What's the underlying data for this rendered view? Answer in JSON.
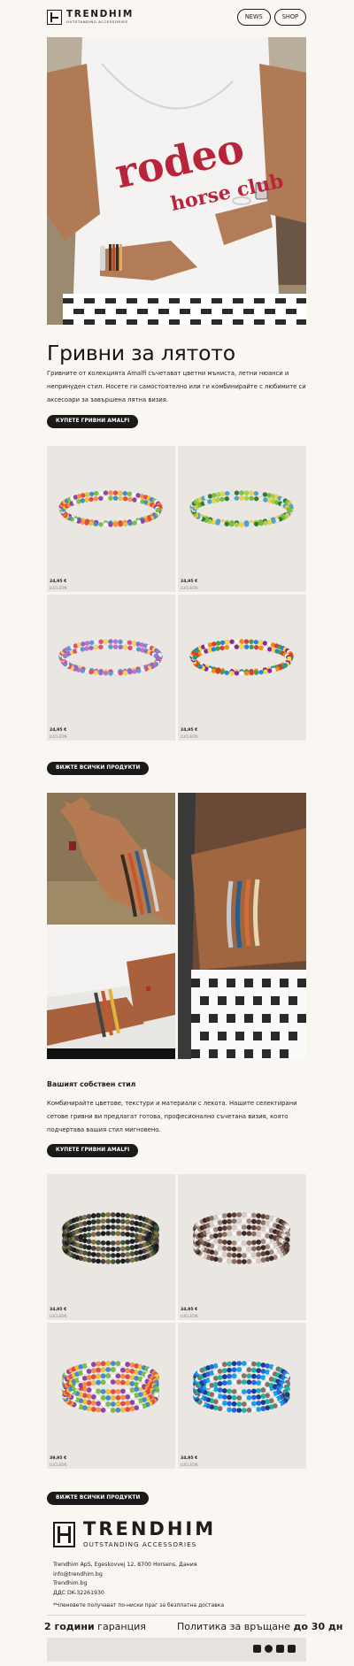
{
  "brand": {
    "name": "TRENDHIM",
    "tagline": "OUTSTANDING ACCESSORIES"
  },
  "nav": {
    "news": "NEWS",
    "shop": "SHOP"
  },
  "hero": {
    "shirt_text_1": "rodeo",
    "shirt_text_2": "horse club"
  },
  "intro": {
    "title": "Гривни за лятото",
    "text": "Гривните от колекцията Amalfi съчетават цветни мъниста, летни нюанси и непринуден стил. Носете ги самостоятелно или ги комбинирайте с любимите си аксесоари за завършена лятна визия.",
    "cta": "КУПЕТЕ ГРИВНИ AMALFI"
  },
  "grid1": [
    {
      "price": "24,95 €",
      "brand": "LUCLEON",
      "palette": "multi"
    },
    {
      "price": "24,95 €",
      "brand": "LUCLEON",
      "palette": "green"
    },
    {
      "price": "24,95 €",
      "brand": "LUCLEON",
      "palette": "purple"
    },
    {
      "price": "24,95 €",
      "brand": "LUCLEON",
      "palette": "mixed"
    }
  ],
  "grid1_cta": "ВИЖТЕ ВСИЧКИ ПРОДУКТИ",
  "style": {
    "title": "Вашият собствен стил",
    "text": "Комбинирайте цветове, текстури и материали с лекота. Нашите селектирани сетове гривни ви предлагат готова, професионално съчетана визия, която подчертава вашия стил мигновено.",
    "cta": "КУПЕТЕ ГРИВНИ AMALFI"
  },
  "grid2": [
    {
      "price": "34,95 €",
      "brand": "LUCLEON",
      "palette": "black"
    },
    {
      "price": "34,95 €",
      "brand": "LUCLEON",
      "palette": "brown"
    },
    {
      "price": "39,95 €",
      "brand": "LUCLEON",
      "palette": "multi"
    },
    {
      "price": "34,95 €",
      "brand": "LUCLEON",
      "palette": "blue"
    }
  ],
  "grid2_cta": "ВИЖТЕ ВСИЧКИ ПРОДУКТИ",
  "footer": {
    "address": [
      "Trendhim ApS, Egeskovvej 12, 8700 Horsens, Дания",
      "info@trendhim.bg",
      "Trendhim.bg",
      "ДДС DK-32261930"
    ],
    "note": "*Членовете получават по-ниски праг за безплатна доставка",
    "guarantee_left_strong": "2 години",
    "guarantee_left_rest": " гаранция",
    "guarantee_right_rest": "Политика за връщане ",
    "guarantee_right_strong": "до 30 дн",
    "socials": [
      "instagram-icon",
      "facebook-icon",
      "tiktok-icon",
      "linkedin-icon"
    ]
  },
  "colors": {
    "background": "#faf7f2",
    "button": "#1a1a1a",
    "card": "#eae6e1"
  }
}
